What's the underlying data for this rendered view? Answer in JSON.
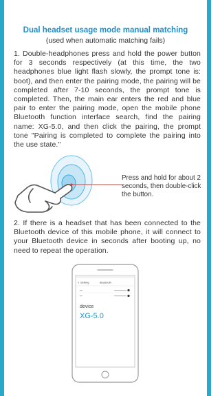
{
  "heading": {
    "title": "Dual headset usage mode manual matching",
    "subtitle": "(used when automatic matching fails)"
  },
  "paragraph1": "1. Double-headphones press and hold the power button for 3 seconds respectively (at this time, the two headphones blue light flash slowly, the prompt tone is: boot), and then enter the pairing mode, the pairing will be completed after 7-10 seconds, the prompt tone is completed. Then, the main ear enters the red and blue pair to enter the pairing mode, open the mobile phone Bluetooth function interface search, find the pairing name: XG-5.0, and then click the pairing, the prompt tone \"Pairing is completed to complete the pairing into the use state.\"",
  "figure_caption": "Press and hold for about 2 seconds, then double-click the button.",
  "paragraph2": "2. If there is a headset that has been connected to the Bluetooth device of this mobile phone, it will connect to your Bluetooth device in seconds after booting up, no need to repeat the operation.",
  "phone": {
    "back_label": "Setting",
    "screen_title": "Bluetooth",
    "section_label": "device",
    "device_name": "XG-5.0"
  },
  "colors": {
    "accent": "#1a8fd0",
    "side_bar": "#2aa8cc",
    "text": "#333333"
  }
}
